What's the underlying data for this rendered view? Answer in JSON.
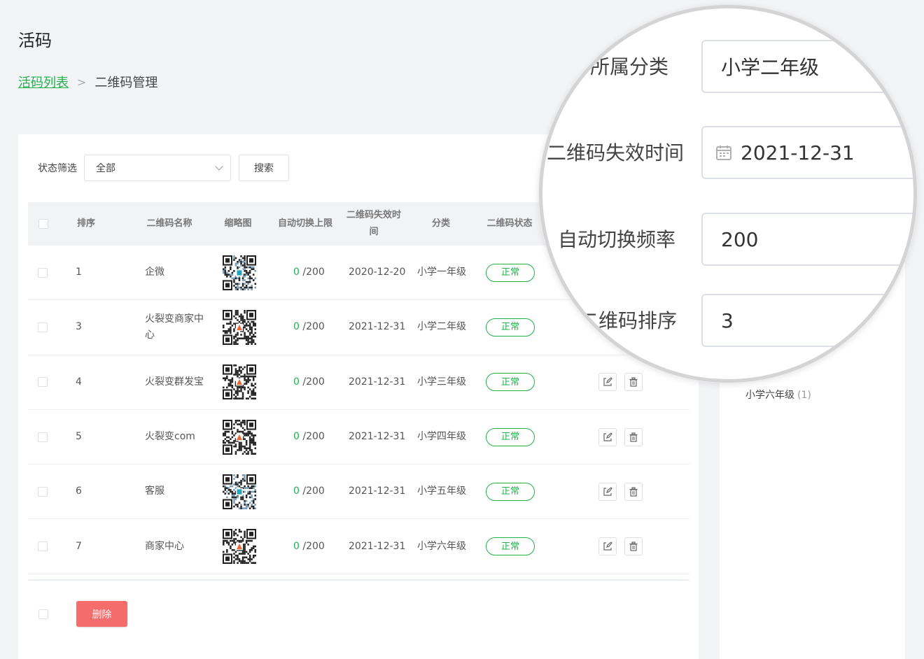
{
  "header": {
    "title": "活码"
  },
  "breadcrumb": {
    "parent": "活码列表",
    "current": "二维码管理"
  },
  "filter": {
    "label": "状态筛选",
    "selected": "全部",
    "search_label": "搜索"
  },
  "table": {
    "columns": {
      "sort": "排序",
      "name": "二维码名称",
      "thumb": "缩略图",
      "switch_limit": "自动切换上限",
      "expire": "二维码失效时间",
      "category": "分类",
      "status": "二维码状态"
    },
    "rows": [
      {
        "sort": "1",
        "name": "企微",
        "count": "0",
        "limit": "/200",
        "expire": "2020-12-20",
        "category": "小学一年级",
        "status": "正常"
      },
      {
        "sort": "3",
        "name": "火裂变商家中心",
        "count": "0",
        "limit": "/200",
        "expire": "2021-12-31",
        "category": "小学二年级",
        "status": "正常"
      },
      {
        "sort": "4",
        "name": "火裂变群发宝",
        "count": "0",
        "limit": "/200",
        "expire": "2021-12-31",
        "category": "小学三年级",
        "status": "正常"
      },
      {
        "sort": "5",
        "name": "火裂变com",
        "count": "0",
        "limit": "/200",
        "expire": "2021-12-31",
        "category": "小学四年级",
        "status": "正常"
      },
      {
        "sort": "6",
        "name": "客服",
        "count": "0",
        "limit": "/200",
        "expire": "2021-12-31",
        "category": "小学五年级",
        "status": "正常"
      },
      {
        "sort": "7",
        "name": "商家中心",
        "count": "0",
        "limit": "/200",
        "expire": "2021-12-31",
        "category": "小学六年级",
        "status": "正常"
      }
    ],
    "delete_label": "删除"
  },
  "sidebar": {
    "items": [
      {
        "label": "小学六年级",
        "count": "(1)"
      }
    ]
  },
  "magnifier": {
    "fields": [
      {
        "label": "所属分类",
        "value": "小学二年级"
      },
      {
        "label": "二维码失效时间",
        "value": "2021-12-31"
      },
      {
        "label": "自动切换频率",
        "value": "200"
      },
      {
        "label": "二维码排序",
        "value": "3"
      }
    ]
  },
  "colors": {
    "accent": "#22b14c",
    "danger": "#f56c6c"
  }
}
